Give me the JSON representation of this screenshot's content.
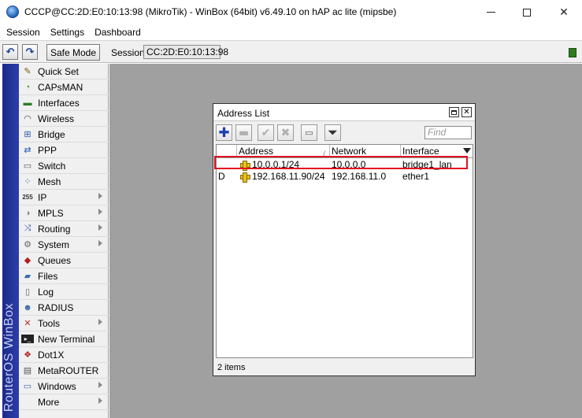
{
  "window": {
    "title": "CCCP@CC:2D:E0:10:13:98 (MikroTik) - WinBox (64bit) v6.49.10 on hAP ac lite (mipsbe)"
  },
  "menubar": {
    "items": [
      "Session",
      "Settings",
      "Dashboard"
    ]
  },
  "toolbar": {
    "undo_icon": "undo-icon",
    "redo_icon": "redo-icon",
    "safe_mode_label": "Safe Mode",
    "session_label": "Session:",
    "session_value": "CC:2D:E0:10:13:98",
    "status_color": "#2e7d1e"
  },
  "brand": {
    "text": "RouterOS WinBox"
  },
  "sidebar": {
    "items": [
      {
        "label": "Quick Set",
        "icon": "wand-icon",
        "submenu": false
      },
      {
        "label": "CAPsMAN",
        "icon": "capsman-icon",
        "submenu": false
      },
      {
        "label": "Interfaces",
        "icon": "interfaces-icon",
        "submenu": false
      },
      {
        "label": "Wireless",
        "icon": "wireless-icon",
        "submenu": false
      },
      {
        "label": "Bridge",
        "icon": "bridge-icon",
        "submenu": false
      },
      {
        "label": "PPP",
        "icon": "ppp-icon",
        "submenu": false
      },
      {
        "label": "Switch",
        "icon": "switch-icon",
        "submenu": false
      },
      {
        "label": "Mesh",
        "icon": "mesh-icon",
        "submenu": false
      },
      {
        "label": "IP",
        "icon": "ip-icon",
        "submenu": true
      },
      {
        "label": "MPLS",
        "icon": "mpls-icon",
        "submenu": true
      },
      {
        "label": "Routing",
        "icon": "routing-icon",
        "submenu": true
      },
      {
        "label": "System",
        "icon": "gear-icon",
        "submenu": true
      },
      {
        "label": "Queues",
        "icon": "queues-icon",
        "submenu": false
      },
      {
        "label": "Files",
        "icon": "folder-icon",
        "submenu": false
      },
      {
        "label": "Log",
        "icon": "log-icon",
        "submenu": false
      },
      {
        "label": "RADIUS",
        "icon": "radius-icon",
        "submenu": false
      },
      {
        "label": "Tools",
        "icon": "tools-icon",
        "submenu": true
      },
      {
        "label": "New Terminal",
        "icon": "terminal-icon",
        "submenu": false
      },
      {
        "label": "Dot1X",
        "icon": "dot1x-icon",
        "submenu": false
      },
      {
        "label": "MetaROUTER",
        "icon": "metarouter-icon",
        "submenu": false
      },
      {
        "label": "Windows",
        "icon": "windows-icon",
        "submenu": true
      },
      {
        "label": "More",
        "icon": "",
        "submenu": true
      }
    ]
  },
  "address_list": {
    "title": "Address List",
    "find_placeholder": "Find",
    "columns": {
      "flag": "",
      "address": "Address",
      "network": "Network",
      "interface": "Interface"
    },
    "rows": [
      {
        "flag": "",
        "address": "10.0.0.1/24",
        "network": "10.0.0.0",
        "interface": "bridge1_lan",
        "highlighted": true
      },
      {
        "flag": "D",
        "address": "192.168.11.90/24",
        "network": "192.168.11.0",
        "interface": "ether1",
        "highlighted": false
      }
    ],
    "status": "2 items",
    "highlight_color": "#e01020"
  }
}
